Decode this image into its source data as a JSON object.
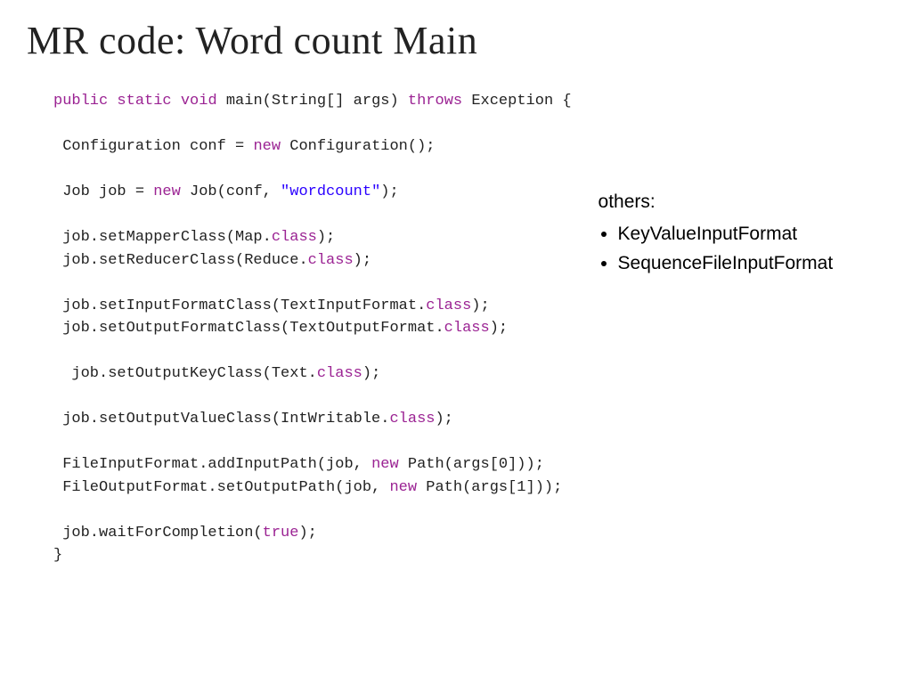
{
  "slide": {
    "title": "MR code: Word count Main"
  },
  "code": {
    "sig_public": "public",
    "sig_static": "static",
    "sig_void": "void",
    "sig_main": " main(String[] args) ",
    "sig_throws": "throws",
    "sig_exception": " Exception {",
    "line_conf_a": " Configuration conf = ",
    "line_conf_new": "new",
    "line_conf_b": " Configuration();",
    "line_job_a": " Job job = ",
    "line_job_new": "new",
    "line_job_b": " Job(conf, ",
    "line_job_str": "\"wordcount\"",
    "line_job_c": ");",
    "line_mapper_a": " job.setMapperClass(Map.",
    "line_mapper_cls": "class",
    "line_mapper_b": ");",
    "line_reducer_a": " job.setReducerClass(Reduce.",
    "line_reducer_cls": "class",
    "line_reducer_b": ");",
    "line_infmt_a": " job.setInputFormatClass(TextInputFormat.",
    "line_infmt_cls": "class",
    "line_infmt_b": ");",
    "line_outfmt_a": " job.setOutputFormatClass(TextOutputFormat.",
    "line_outfmt_cls": "class",
    "line_outfmt_b": ");",
    "line_outkey_a": "  job.setOutputKeyClass(Text.",
    "line_outkey_cls": "class",
    "line_outkey_b": ");",
    "line_outval_a": " job.setOutputValueClass(IntWritable.",
    "line_outval_cls": "class",
    "line_outval_b": ");",
    "line_inpath_a": " FileInputFormat.addInputPath(job, ",
    "line_inpath_new": "new",
    "line_inpath_b": " Path(args[0]));",
    "line_outpath_a": " FileOutputFormat.setOutputPath(job, ",
    "line_outpath_new": "new",
    "line_outpath_b": " Path(args[1]));",
    "line_wait_a": " job.waitForCompletion(",
    "line_wait_true": "true",
    "line_wait_b": ");",
    "close_brace": "}"
  },
  "annotation": {
    "heading": "others:",
    "items": [
      "KeyValueInputFormat",
      "SequenceFileInputFormat"
    ]
  }
}
